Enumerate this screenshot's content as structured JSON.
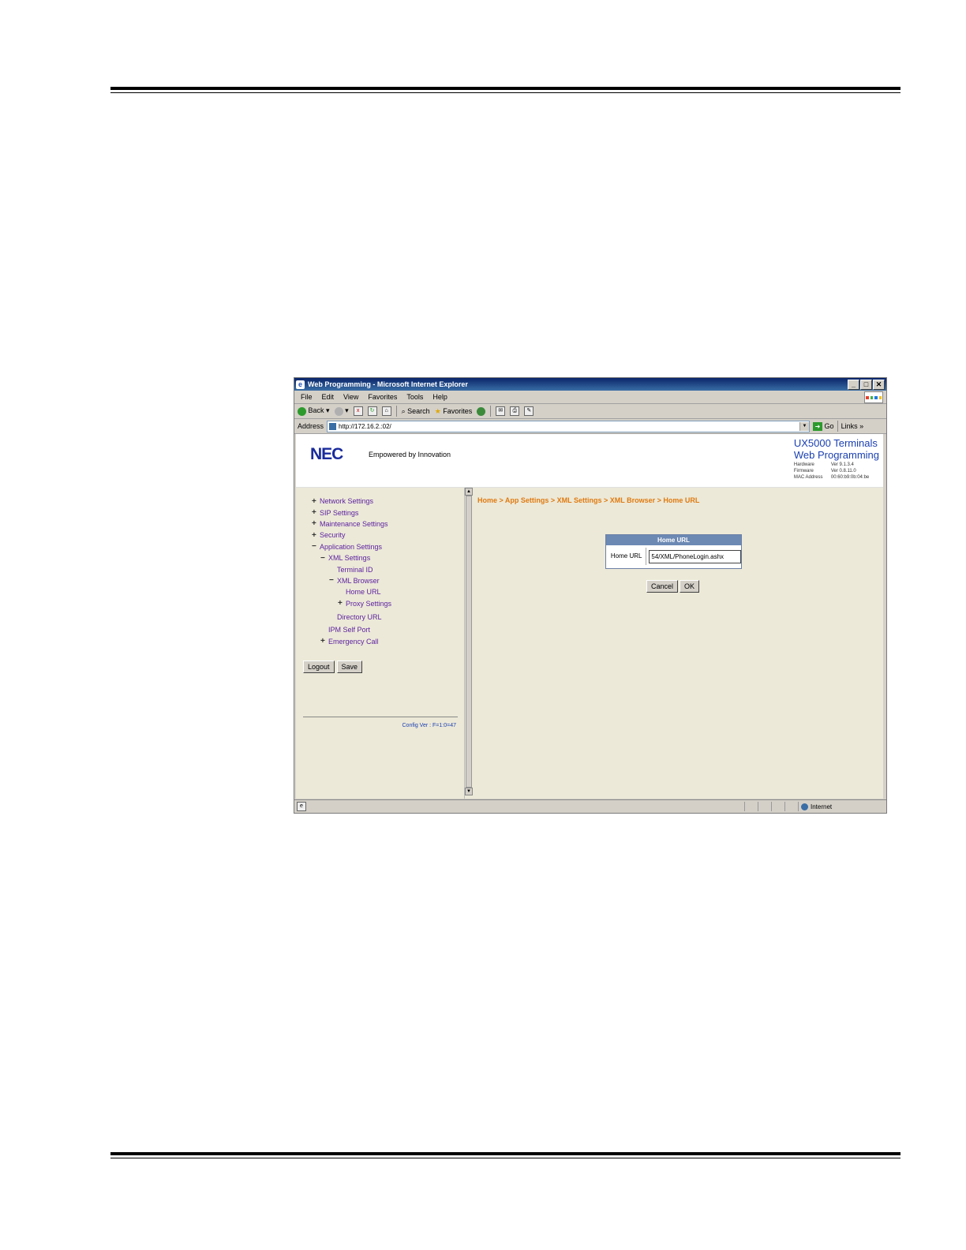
{
  "window": {
    "title": "Web Programming - Microsoft Internet Explorer",
    "controls": [
      "_",
      "□",
      "✕"
    ]
  },
  "menu": [
    "File",
    "Edit",
    "View",
    "Favorites",
    "Tools",
    "Help"
  ],
  "toolbar": {
    "back": "Back",
    "search": "Search",
    "favorites": "Favorites"
  },
  "address": {
    "label": "Address",
    "value": "http://172.16.2.:02/",
    "go": "Go",
    "links": "Links"
  },
  "header": {
    "logo": "NEC",
    "tagline": "Empowered by Innovation",
    "product_line1": "UX5000 Terminals",
    "product_line2": "Web Programming",
    "hardware_label": "Hardware",
    "hardware_value": "Ver 9.1.3.4",
    "firmware_label": "Firmware",
    "firmware_value": "Ver 0.8.11.0",
    "mac_label": "MAC Address",
    "mac_value": "00:60:b9:0b:04:be"
  },
  "tree": [
    {
      "label": "Network Settings",
      "icon": "+",
      "indent": 0
    },
    {
      "label": "SIP Settings",
      "icon": "+",
      "indent": 0
    },
    {
      "label": "Maintenance Settings",
      "icon": "+",
      "indent": 0
    },
    {
      "label": "Security",
      "icon": "+",
      "indent": 0
    },
    {
      "label": "Application Settings",
      "icon": "−",
      "indent": 0
    },
    {
      "label": "XML Settings",
      "icon": "−",
      "indent": 1
    },
    {
      "label": "Terminal ID",
      "icon": "",
      "indent": 2
    },
    {
      "label": "XML Browser",
      "icon": "−",
      "indent": 2
    },
    {
      "label": "Home URL",
      "icon": "",
      "indent": 3
    },
    {
      "label": "Proxy Settings",
      "icon": "+",
      "indent": 3
    },
    {
      "label": "Directory URL",
      "icon": "",
      "indent": 2
    },
    {
      "label": "IPM Self Port",
      "icon": "",
      "indent": 1
    },
    {
      "label": "Emergency Call",
      "icon": "+",
      "indent": 1
    }
  ],
  "left_buttons": {
    "logout": "Logout",
    "save": "Save"
  },
  "config_ver": "Config Ver : F=1:0=47",
  "breadcrumb": "Home > App Settings > XML Settings > XML Browser > Home URL",
  "form": {
    "header": "Home URL",
    "label": "Home URL",
    "value": "54/XML/PhoneLogin.ashx",
    "cancel": "Cancel",
    "ok": "OK"
  },
  "status": {
    "zone": "Internet"
  },
  "colors": {
    "title_bar": "#0a246a",
    "breadcrumb": "#e07a10",
    "tree_link": "#5a1e9e",
    "form_header": "#6c89b4"
  }
}
